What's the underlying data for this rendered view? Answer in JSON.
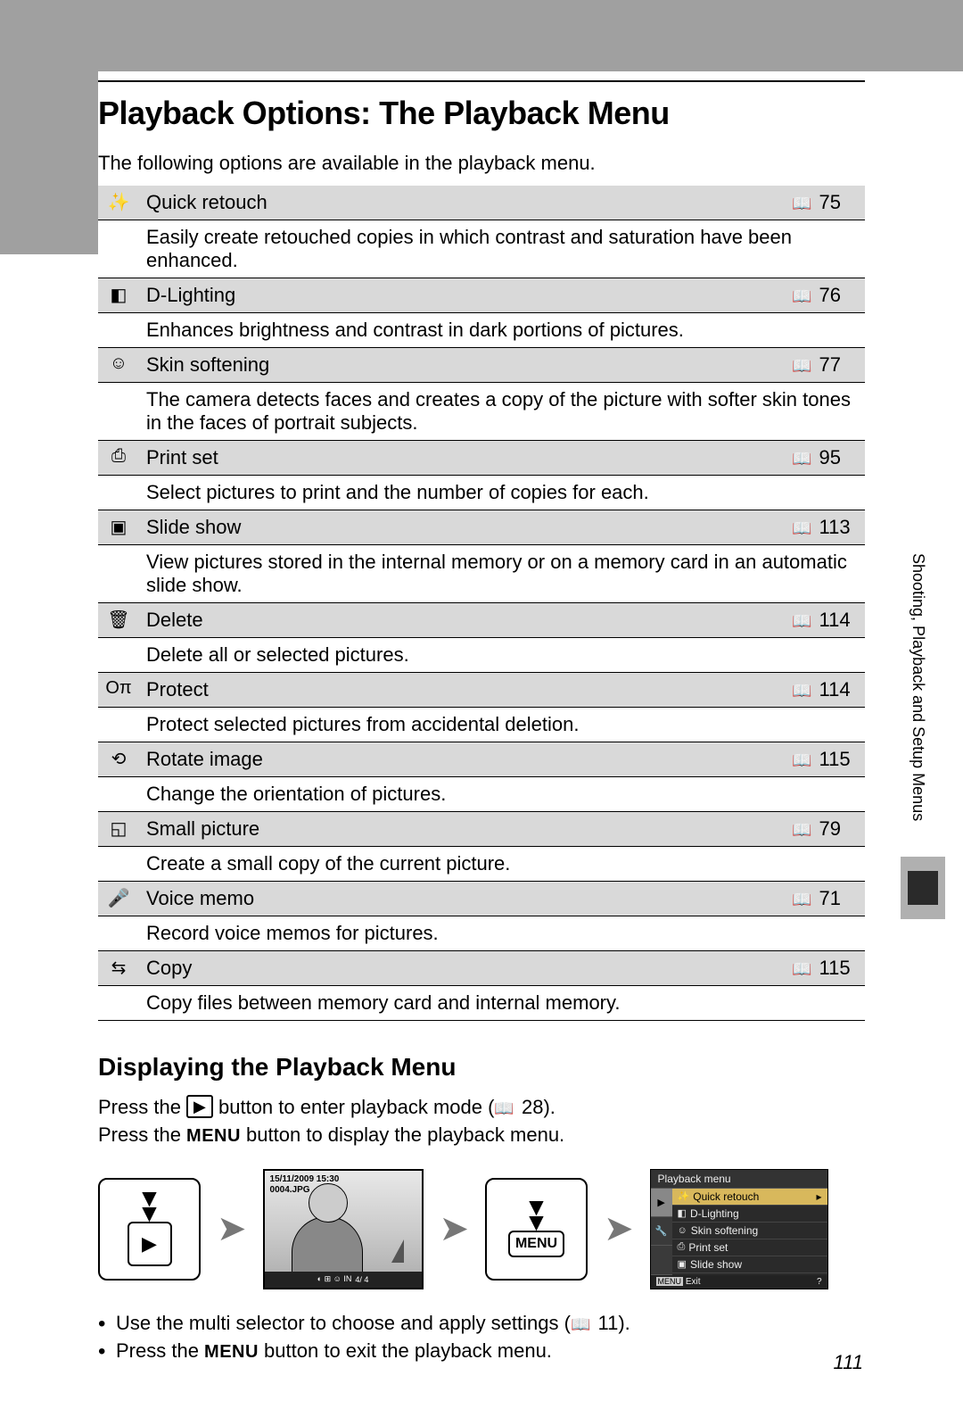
{
  "page_title": "Playback Options: The Playback Menu",
  "intro": "The following options are available in the playback menu.",
  "items": [
    {
      "icon": "✨",
      "label": "Quick retouch",
      "page": "75",
      "desc": "Easily create retouched copies in which contrast and saturation have been enhanced."
    },
    {
      "icon": "◧",
      "label": "D-Lighting",
      "page": "76",
      "desc": "Enhances brightness and contrast in dark portions of pictures."
    },
    {
      "icon": "☺",
      "label": "Skin softening",
      "page": "77",
      "desc": "The camera detects faces and creates a copy of the picture with softer skin tones in the faces of portrait subjects."
    },
    {
      "icon": "⎙",
      "label": "Print set",
      "page": "95",
      "desc": "Select pictures to print and the number of copies for each."
    },
    {
      "icon": "▣",
      "label": "Slide show",
      "page": "113",
      "desc": "View pictures stored in the internal memory or on a memory card in an automatic slide show."
    },
    {
      "icon": "🗑",
      "label": "Delete",
      "page": "114",
      "desc": "Delete all or selected pictures."
    },
    {
      "icon": "Oπ",
      "label": "Protect",
      "page": "114",
      "desc": "Protect selected pictures from accidental deletion."
    },
    {
      "icon": "⟲",
      "label": "Rotate image",
      "page": "115",
      "desc": "Change the orientation of pictures."
    },
    {
      "icon": "◱",
      "label": "Small picture",
      "page": "79",
      "desc": "Create a small copy of the current picture."
    },
    {
      "icon": "🎤",
      "label": "Voice memo",
      "page": "71",
      "desc": "Record voice memos for pictures."
    },
    {
      "icon": "⇆",
      "label": "Copy",
      "page": "115",
      "desc": "Copy files between memory card and internal memory."
    }
  ],
  "section2_title": "Displaying the Playback Menu",
  "step1a": "Press the ",
  "play_glyph": "▶",
  "step1b": " button to enter playback mode (",
  "step1_page": "28",
  "step1c": ").",
  "step2a": "Press the ",
  "menu_word": "MENU",
  "step2b": " button to display the playback menu.",
  "lcd_date": "15/11/2009 15:30",
  "lcd_file": "0004.JPG",
  "lcd_counter": "4/ 4",
  "lcd_menu_title": "Playback menu",
  "lcd_menu_items": [
    "Quick retouch",
    "D-Lighting",
    "Skin softening",
    "Print set",
    "Slide show"
  ],
  "lcd_exit": "Exit",
  "lcd_help": "?",
  "bullet1a": "Use the multi selector to choose and apply settings (",
  "bullet1_page": "11",
  "bullet1b": ").",
  "bullet2a": "Press the ",
  "bullet2b": " button to exit the playback menu.",
  "side_label": "Shooting, Playback and Setup Menus",
  "page_number": "111"
}
